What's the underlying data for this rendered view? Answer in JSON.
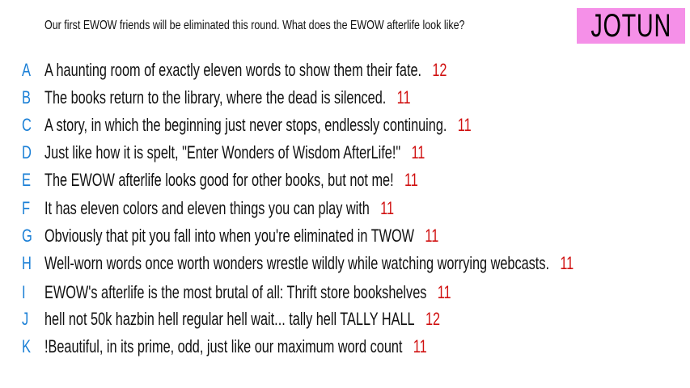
{
  "prompt": "Our first EWOW friends will be eliminated this round. What does the EWOW afterlife look like?",
  "badge": "JOTUN",
  "colors": {
    "letter": "#1a7fd6",
    "count": "#d01010",
    "badge_bg": "#f590e8"
  },
  "responses": [
    {
      "letter": "A",
      "text": "A haunting room of exactly eleven words to show them their fate.",
      "count": "12"
    },
    {
      "letter": "B",
      "text": "The books return to the library, where the dead is silenced.",
      "count": "11"
    },
    {
      "letter": "C",
      "text": "A story, in which the beginning just never stops, endlessly continuing.",
      "count": "11"
    },
    {
      "letter": "D",
      "text": "Just like how it is spelt, \"Enter Wonders of Wisdom AfterLife!\"",
      "count": "11"
    },
    {
      "letter": "E",
      "text": "The EWOW afterlife looks good for other books, but not me!",
      "count": "11"
    },
    {
      "letter": "F",
      "text": "It has eleven colors and eleven things you can play with",
      "count": "11"
    },
    {
      "letter": "G",
      "text": "Obviously that pit you fall into when you're eliminated in TWOW",
      "count": "11"
    },
    {
      "letter": "H",
      "text": "Well-worn words once worth wonders wrestle wildly while watching worrying webcasts.",
      "count": "11"
    },
    {
      "letter": "I",
      "text": "EWOW's afterlife is the most brutal of all: Thrift store bookshelves",
      "count": "11"
    },
    {
      "letter": "J",
      "text": "hell not 50k hazbin hell regular hell wait... tally hell TALLY HALL",
      "count": "12"
    },
    {
      "letter": "K",
      "text": "!Beautiful, in its prime, odd, just like our maximum word count",
      "count": "11"
    }
  ]
}
